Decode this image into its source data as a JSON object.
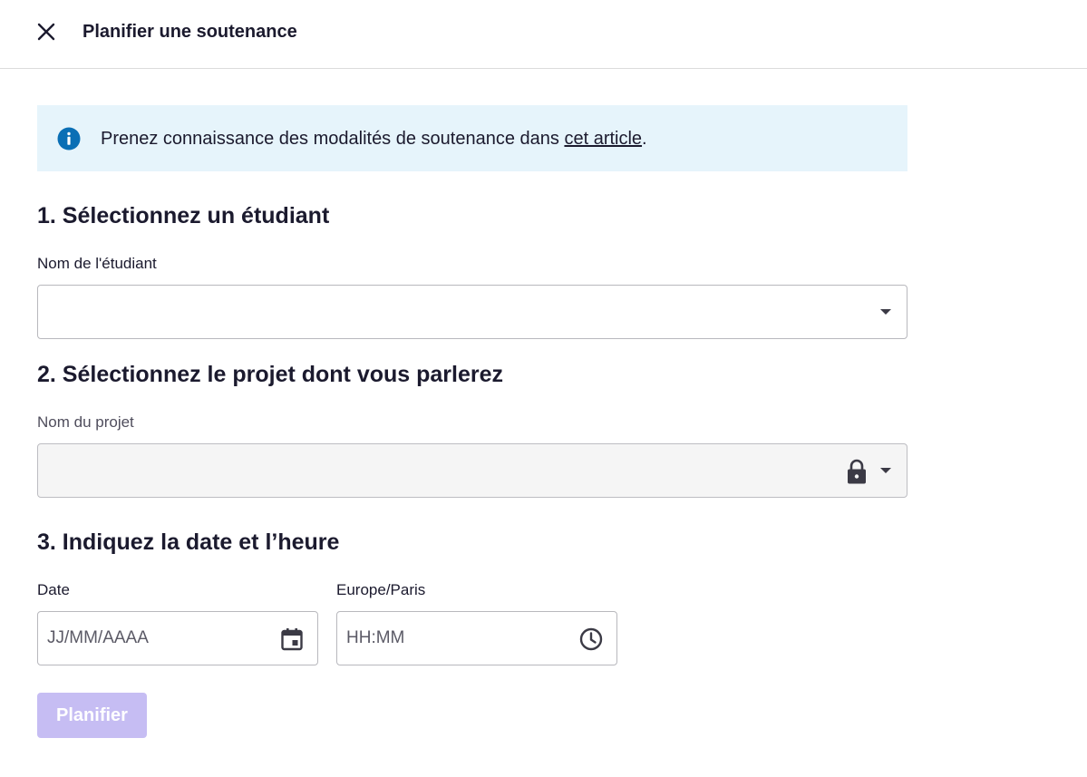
{
  "header": {
    "close_icon": "close-icon",
    "title": "Planifier une soutenance"
  },
  "info_banner": {
    "icon": "info-icon",
    "text_before": "Prenez connaissance des modalités de soutenance dans ",
    "link_text": "cet article",
    "text_after": ".",
    "background_color": "#e6f4fb",
    "icon_color": "#0a6fb5"
  },
  "step1": {
    "title": "1. Sélectionnez un étudiant",
    "field_label": "Nom de l'étudiant",
    "value": ""
  },
  "step2": {
    "title": "2. Sélectionnez le projet dont vous parlerez",
    "field_label": "Nom du projet",
    "value": "",
    "disabled": true,
    "lock_icon": "lock-icon"
  },
  "step3": {
    "title": "3. Indiquez la date et l’heure",
    "date": {
      "label": "Date",
      "placeholder": "JJ/MM/AAAA",
      "icon": "calendar-icon"
    },
    "time": {
      "label": "Europe/Paris",
      "placeholder": "HH:MM",
      "icon": "clock-icon"
    }
  },
  "submit": {
    "label": "Planifier",
    "disabled": true,
    "color": "#c6bdf3"
  }
}
